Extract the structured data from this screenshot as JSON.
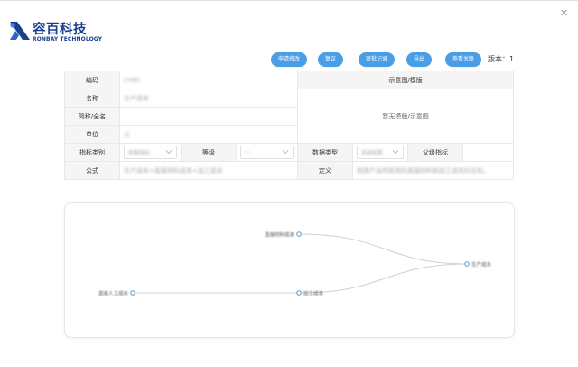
{
  "brand": {
    "name": "容百科技",
    "sub": "RONBAY TECHNOLOGY"
  },
  "toolbar": {
    "buttons": [
      "申请修改",
      "复议",
      "审批记录",
      "导出",
      "查看关联"
    ],
    "version_label": "版本：",
    "version_value": "1"
  },
  "form": {
    "code_label": "编码",
    "code_value": "CYBS",
    "name_label": "名称",
    "name_value": "生产成本",
    "fullname_label": "简称/全名",
    "unit_label": "单位",
    "unit_value": "元",
    "diagram_header": "示意图/模版",
    "diagram_empty": "暂无模版/示意图",
    "category_label": "指标类别",
    "category_value": "结果指标",
    "level_label": "等级",
    "level_value": "一",
    "datatype_label": "数据类型",
    "datatype_value": "系统取数",
    "parent_label": "父级指标",
    "formula_label": "公式",
    "formula_value": "生产成本=直接材料成本+加工成本",
    "definition_label": "定义",
    "definition_value": "制造产品所耗用的直接材料和加工成本的总和。"
  },
  "graph": {
    "nodes": [
      {
        "id": "n1",
        "label": "直接材料成本"
      },
      {
        "id": "n2",
        "label": "直接人工成本"
      },
      {
        "id": "n3",
        "label": "加工成本"
      },
      {
        "id": "n4",
        "label": "生产成本"
      }
    ]
  },
  "colors": {
    "primary": "#4a9ee8",
    "brand": "#1b3f8f",
    "node": "#5b9bd5"
  }
}
